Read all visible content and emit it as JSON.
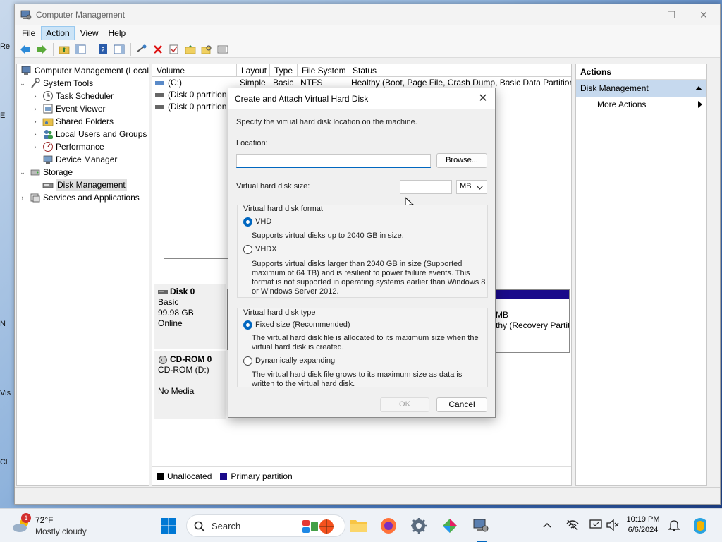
{
  "window": {
    "title": "Computer Management",
    "controls": {
      "minimize": "—",
      "maximize": "☐",
      "close": "✕"
    }
  },
  "menu": [
    "File",
    "Action",
    "View",
    "Help"
  ],
  "tree": [
    {
      "label": "Computer Management (Local",
      "level": 0,
      "chev": ""
    },
    {
      "label": "System Tools",
      "level": 1,
      "chev": "⌄"
    },
    {
      "label": "Task Scheduler",
      "level": 2,
      "chev": "›"
    },
    {
      "label": "Event Viewer",
      "level": 2,
      "chev": "›"
    },
    {
      "label": "Shared Folders",
      "level": 2,
      "chev": "›"
    },
    {
      "label": "Local Users and Groups",
      "level": 2,
      "chev": "›"
    },
    {
      "label": "Performance",
      "level": 2,
      "chev": "›"
    },
    {
      "label": "Device Manager",
      "level": 2,
      "chev": ""
    },
    {
      "label": "Storage",
      "level": 1,
      "chev": "⌄"
    },
    {
      "label": "Disk Management",
      "level": 2,
      "chev": ""
    },
    {
      "label": "Services and Applications",
      "level": 1,
      "chev": "›"
    }
  ],
  "volumes": {
    "headers": [
      "Volume",
      "Layout",
      "Type",
      "File System",
      "Status"
    ],
    "rows": [
      [
        "(C:)",
        "Simple",
        "Basic",
        "NTFS",
        "Healthy (Boot, Page File, Crash Dump, Basic Data Partition)"
      ],
      [
        "(Disk 0 partition",
        "",
        "",
        "",
        ""
      ],
      [
        "(Disk 0 partition",
        "",
        "",
        "",
        ""
      ]
    ]
  },
  "disks": [
    {
      "name": "Disk 0",
      "type": "Basic",
      "size": "99.98 GB",
      "status": "Online"
    },
    {
      "name": "CD-ROM 0",
      "type": "CD-ROM (D:)",
      "size": "",
      "status": "No Media"
    }
  ],
  "partition_fragment": {
    "line1": "MB",
    "line2": "thy (Recovery Partit"
  },
  "legend": [
    {
      "label": "Unallocated",
      "color": "#000000"
    },
    {
      "label": "Primary partition",
      "color": "#1a0a8a"
    }
  ],
  "actions": {
    "header": "Actions",
    "section": "Disk Management",
    "items": [
      "More Actions"
    ]
  },
  "dialog": {
    "title": "Create and Attach Virtual Hard Disk",
    "intro": "Specify the virtual hard disk location on the machine.",
    "location_label": "Location:",
    "location_value": "",
    "browse": "Browse...",
    "size_label": "Virtual hard disk size:",
    "size_value": "",
    "size_unit": "MB",
    "format_group": "Virtual hard disk format",
    "vhd_label": "VHD",
    "vhd_desc": "Supports virtual disks up to 2040 GB in size.",
    "vhdx_label": "VHDX",
    "vhdx_desc": "Supports virtual disks larger than 2040 GB in size (Supported maximum of 64 TB) and is resilient to power failure events. This format is not supported in operating systems earlier than Windows 8 or Windows Server 2012.",
    "type_group": "Virtual hard disk type",
    "fixed_label": "Fixed size (Recommended)",
    "fixed_desc": "The virtual hard disk file is allocated to its maximum size when the virtual hard disk is created.",
    "dynamic_label": "Dynamically expanding",
    "dynamic_desc": "The virtual hard disk file grows to its maximum size as data is written to the virtual hard disk.",
    "ok": "OK",
    "cancel": "Cancel"
  },
  "taskbar": {
    "weather_temp": "72°F",
    "weather_desc": "Mostly cloudy",
    "weather_badge": "1",
    "search": "Search",
    "time": "10:19 PM",
    "date": "6/6/2024"
  },
  "desktop_labels": [
    "Re",
    "E",
    "N",
    "Vis",
    "Cl"
  ]
}
